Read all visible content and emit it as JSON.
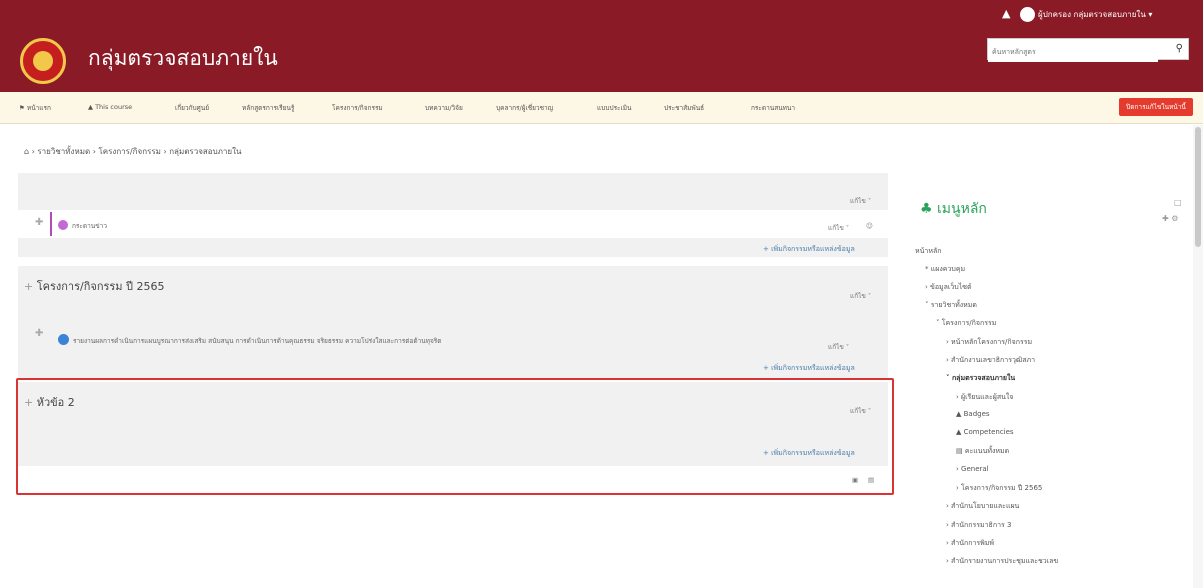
{
  "topbar": {
    "notification_icon": "bell-icon",
    "user_name": "ผู้ปกครอง กลุ่มตรวจสอบภายใน ▾"
  },
  "header": {
    "title": "กลุ่มตรวจสอบภายใน",
    "search_placeholder": "ค้นหาหลักสูตร",
    "search_icon": "search-icon"
  },
  "nav": {
    "items": [
      "หน้าแรก",
      "This course",
      "เกี่ยวกับศูนย์",
      "หลักสูตรการเรียนรู้",
      "โครงการ/กิจกรรม",
      "บทความ/วิจัย",
      "บุคลากร/ผู้เชี่ยวชาญ",
      "แบบประเมิน",
      "ประชาสัมพันธ์",
      "กระดานสนทนา"
    ],
    "action_button": "ปิดการแก้ไขในหน้านี้"
  },
  "breadcrumb": {
    "home_icon": "home-icon",
    "items": [
      "รายวิชาทั้งหมด",
      "โครงการ/กิจกรรม",
      "กลุ่มตรวจสอบภายใน"
    ]
  },
  "sections": [
    {
      "edit_label": "แก้ไข ˅",
      "activity_label": "กระดานข่าว",
      "activity_edit": "แก้ไข ˅",
      "add_label": "+ เพิ่มกิจกรรมหรือแหล่งข้อมูล"
    },
    {
      "title": "โครงการ/กิจกรรม ปี 2565",
      "edit_label": "แก้ไข ˅",
      "activity_label": "รายงานผลการดำเนินการแผนบูรณาการส่งเสริม สนับสนุน การดำเนินการด้านคุณธรรม จริยธรรม ความโปร่งใสและการต่อต้านทุจริต",
      "activity_edit": "แก้ไข ˅",
      "add_label": "+ เพิ่มกิจกรรมหรือแหล่งข้อมูล"
    },
    {
      "title": "หัวข้อ 2",
      "edit_label": "แก้ไข ˅",
      "add_label": "+ เพิ่มกิจกรรมหรือแหล่งข้อมูล"
    }
  ],
  "sidebar": {
    "title": "เมนูหลัก",
    "items": [
      "หน้าหลัก",
      "แผงควบคุม",
      "ข้อมูลเว็บไซต์",
      "รายวิชาทั้งหมด",
      "โครงการ/กิจกรรม",
      "หน้าหลักโครงการ/กิจกรรม",
      "สำนักงานเลขาธิการวุฒิสภา",
      "กลุ่มตรวจสอบภายใน",
      "ผู้เรียนและผู้สนใจ",
      "Badges",
      "Competencies",
      "คะแนนทั้งหมด",
      "General",
      "โครงการ/กิจกรรม ปี 2565",
      "สำนักนโยบายและแผน",
      "สำนักกรรมาธิการ 3",
      "สำนักการพิมพ์",
      "สำนักรายงานการประชุมและชวเลข"
    ]
  }
}
